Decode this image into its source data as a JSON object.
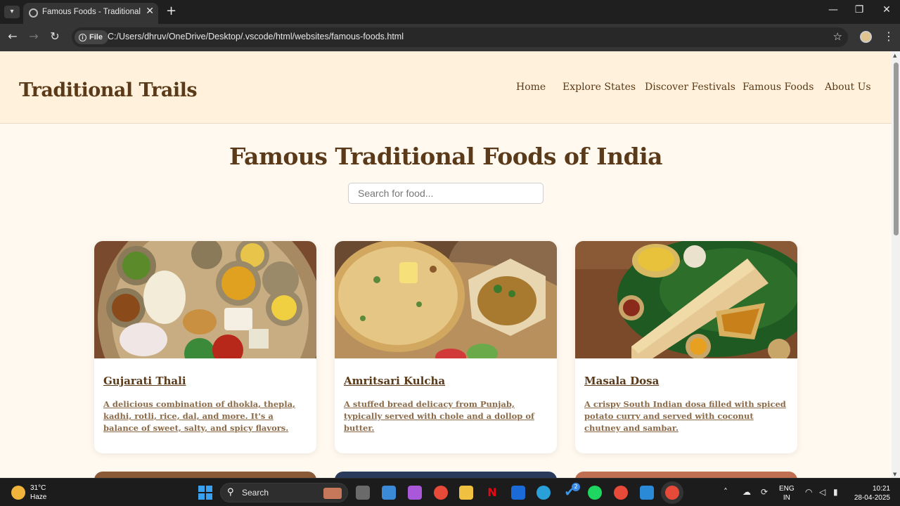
{
  "browser": {
    "tab_title": "Famous Foods - Traditional Trails",
    "close_tab": "✕",
    "new_tab": "+",
    "file_chip": "File",
    "url": "C:/Users/dhruv/OneDrive/Desktop/.vscode/html/websites/famous-foods.html"
  },
  "site": {
    "logo": "Traditional Trails",
    "nav": [
      "Home",
      "Explore States",
      "Discover Festivals",
      "Famous Foods",
      "About Us"
    ]
  },
  "main": {
    "title": "Famous Traditional Foods of India",
    "search_placeholder": "Search for food..."
  },
  "foods": [
    {
      "name": "Gujarati Thali",
      "description": "A delicious combination of dhokla, thepla, kadhi, rotli, rice, dal, and more. It's a balance of sweet, salty, and spicy flavors."
    },
    {
      "name": "Amritsari Kulcha",
      "description": "A stuffed bread delicacy from Punjab, typically served with chole and a dollop of butter."
    },
    {
      "name": "Masala Dosa",
      "description": "A crispy South Indian dosa filled with spiced potato curry and served with coconut chutney and sambar."
    }
  ],
  "taskbar": {
    "temperature": "31°C",
    "condition": "Haze",
    "search_label": "Search",
    "lang_top": "ENG",
    "lang_bottom": "IN",
    "time": "10:21",
    "date": "28-04-2025",
    "badge": "2"
  },
  "colors": {
    "header_bg": "#fff1dc",
    "page_bg": "#fff9f0",
    "brand_brown": "#5a3a18",
    "desc_brown": "#8a6a48"
  }
}
